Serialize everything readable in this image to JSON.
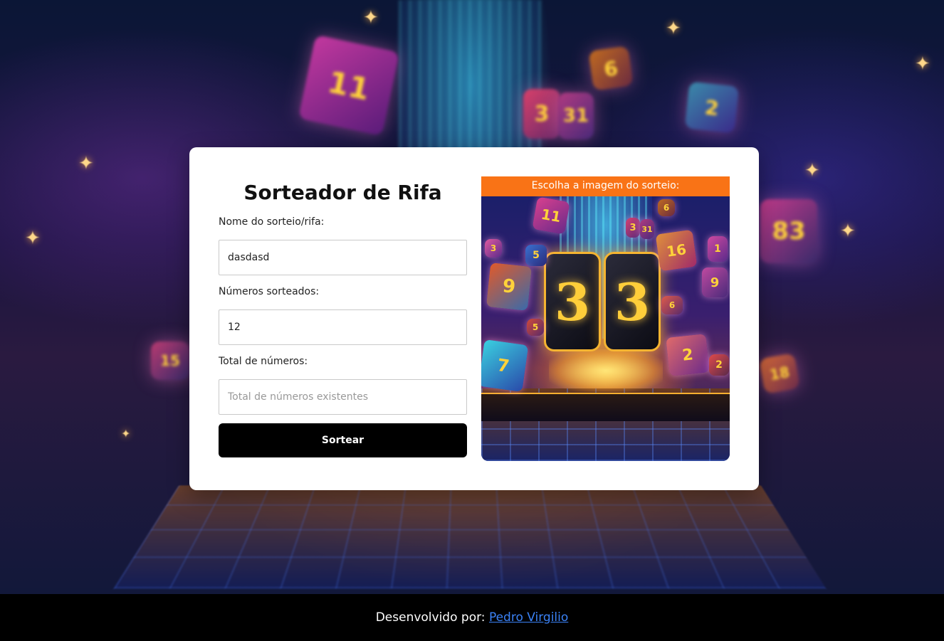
{
  "form": {
    "title": "Sorteador de Rifa",
    "name_label": "Nome do sorteio/rifa:",
    "name_value": "dasdasd",
    "drawn_label": "Números sorteados:",
    "drawn_value": "12",
    "total_label": "Total de números:",
    "total_placeholder": "Total de números existentes",
    "submit_label": "Sortear"
  },
  "image_panel": {
    "header": "Escolha a imagem do sorteio:",
    "big_digits": [
      "3",
      "3"
    ],
    "dice_digits": [
      "11",
      "6",
      "3",
      "31",
      "16",
      "5",
      "9",
      "1",
      "9",
      "5",
      "2",
      "6",
      "7",
      "2",
      "3"
    ]
  },
  "background": {
    "cube_digits": [
      "11",
      "6",
      "3",
      "31",
      "2",
      "83",
      "15",
      "18"
    ]
  },
  "footer": {
    "prefix": "Desenvolvido por:",
    "author_link": "Pedro Virgilio"
  },
  "colors": {
    "accent_orange": "#f97316",
    "button_black": "#000000",
    "link_blue": "#3b82f6"
  }
}
